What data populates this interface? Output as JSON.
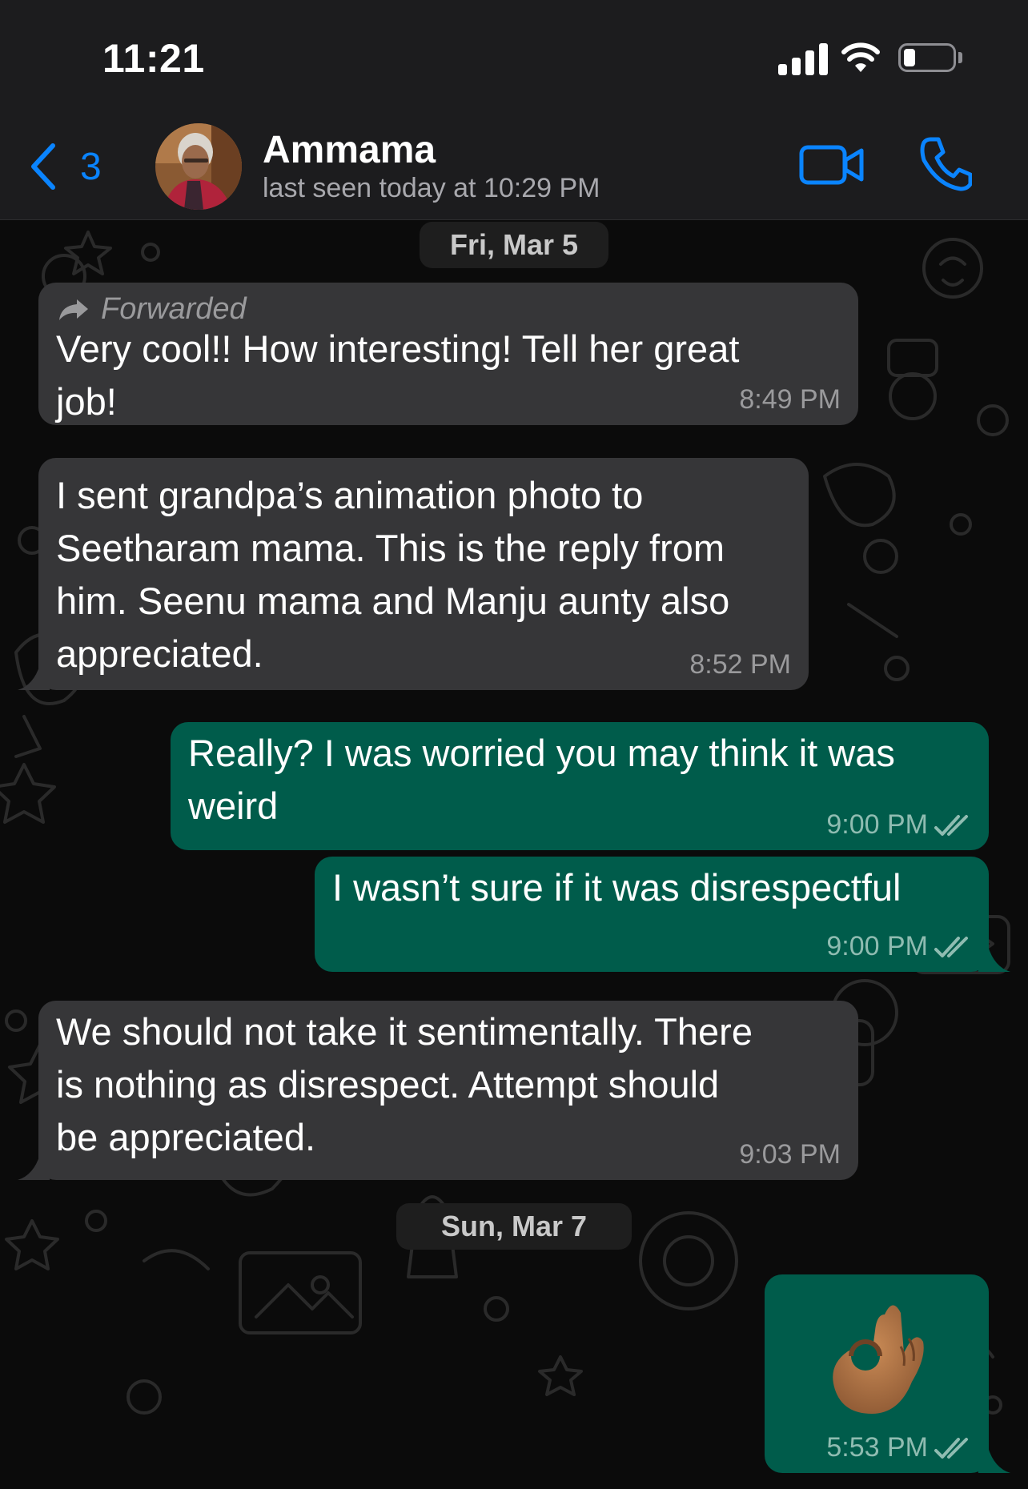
{
  "status_bar": {
    "time": "11:21"
  },
  "header": {
    "back_count": "3",
    "contact_name": "Ammama",
    "last_seen": "last seen today at 10:29 PM"
  },
  "colors": {
    "accent": "#0a84ff",
    "incoming_bubble": "#363638",
    "outgoing_bubble": "#005c4b",
    "background": "#0b0b0b"
  },
  "chat": {
    "date_1": "Fri, Mar 5",
    "date_2": "Sun, Mar 7",
    "messages": [
      {
        "direction": "in",
        "forwarded_label": "Forwarded",
        "text": "Very cool!!  How interesting!  Tell her great\njob!",
        "time": "8:49 PM"
      },
      {
        "direction": "in",
        "text": "I sent grandpa’s animation photo to\nSeetharam mama. This is the reply from\nhim. Seenu mama and Manju aunty also\nappreciated.",
        "time": "8:52 PM"
      },
      {
        "direction": "out",
        "text": "Really? I was worried you may think it was\nweird",
        "time": "9:00 PM",
        "status": "read"
      },
      {
        "direction": "out",
        "text": "I wasn’t sure if it was disrespectful",
        "time": "9:00 PM",
        "status": "read"
      },
      {
        "direction": "in",
        "text": "We should not take it sentimentally. There\nis nothing as disrespect. Attempt should\nbe appreciated.",
        "time": "9:03 PM"
      },
      {
        "direction": "out",
        "emoji": "ok-hand-emoji",
        "time": "5:53 PM",
        "status": "read"
      }
    ]
  }
}
